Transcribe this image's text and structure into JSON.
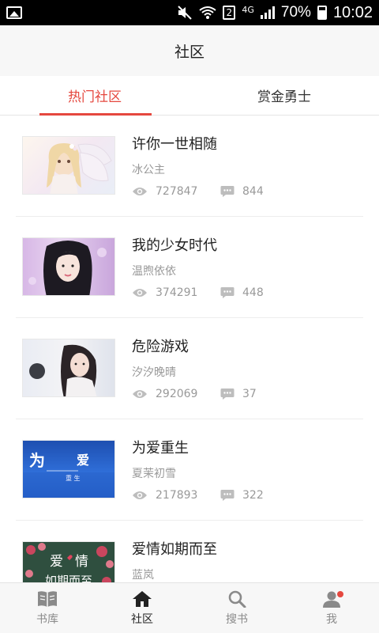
{
  "status_bar": {
    "battery_pct": "70%",
    "sim_slot": "2",
    "network": "4G",
    "time": "10:02",
    "icons": [
      "image-icon",
      "mute-icon",
      "wifi-icon",
      "sim-icon",
      "signal-icon",
      "battery-icon"
    ]
  },
  "header": {
    "title": "社区"
  },
  "tabs": [
    {
      "label": "热门社区",
      "active": true
    },
    {
      "label": "赏金勇士",
      "active": false
    }
  ],
  "list": [
    {
      "title": "许你一世相随",
      "author": "冰公主",
      "views": "727847",
      "comments": "844"
    },
    {
      "title": "我的少女时代",
      "author": "温煦依依",
      "views": "374291",
      "comments": "448"
    },
    {
      "title": "危险游戏",
      "author": "汐汐晚晴",
      "views": "292069",
      "comments": "37"
    },
    {
      "title": "为爱重生",
      "author": "夏茉初雪",
      "views": "217893",
      "comments": "322",
      "cover_text": [
        "为",
        "爱",
        "重 生"
      ]
    },
    {
      "title": "爱情如期而至",
      "author": "蓝岚",
      "cover_text": [
        "爱",
        "情",
        "如期而至"
      ]
    }
  ],
  "bottom_nav": [
    {
      "label": "书库",
      "icon": "book-icon",
      "active": false
    },
    {
      "label": "社区",
      "icon": "home-icon",
      "active": true
    },
    {
      "label": "搜书",
      "icon": "search-icon",
      "active": false
    },
    {
      "label": "我",
      "icon": "user-icon",
      "active": false,
      "badge": true
    }
  ],
  "colors": {
    "accent": "#e5483f",
    "text": "#222222",
    "muted": "#999999",
    "bar": "#f7f7f7"
  }
}
